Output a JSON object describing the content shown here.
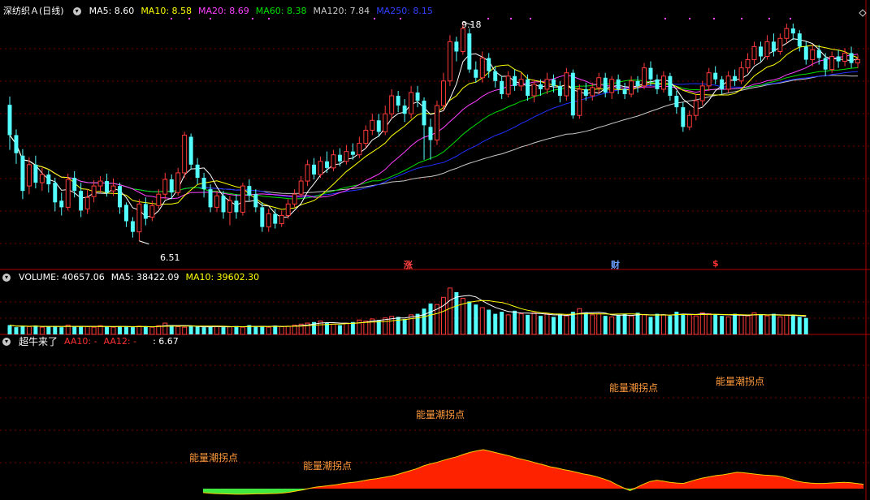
{
  "price_header": {
    "stock_name": "深纺织Ａ(日线)",
    "ma5": "MA5: 8.60",
    "ma10": "MA10: 8.58",
    "ma20": "MA20: 8.69",
    "ma60": "MA60: 8.38",
    "ma120": "MA120: 7.84",
    "ma250": "MA250: 8.15",
    "toggle_icon": "chevron-down-icon"
  },
  "volume_header": {
    "title": "VOLUME: 40657.06",
    "ma5": "MA5: 38422.09",
    "ma10": "MA10: 39602.30"
  },
  "indicator_header": {
    "title": "超牛来了",
    "aa10": "AA10: -",
    "aa12": "AA12: -",
    "value": ": 6.67"
  },
  "price_annotations": {
    "high_label": "9.18",
    "low_label": "6.51"
  },
  "event_markers": [
    {
      "text": "涨",
      "color": "#ff4040"
    },
    {
      "text": "财",
      "color": "#6aa0ff"
    },
    {
      "text": "$",
      "color": "#ff3030"
    }
  ],
  "indicator_labels": [
    "能量潮拐点",
    "能量潮拐点",
    "能量潮拐点",
    "能量潮拐点",
    "能量潮拐点"
  ],
  "colors": {
    "up": "#ff3a3a",
    "down": "#54ffff",
    "ma5": "#ffffff",
    "ma10": "#ffff00",
    "ma20": "#ff40ff",
    "ma60": "#00e000",
    "ma120": "#c8c8c8",
    "ma250": "#2030ff",
    "indicator_positive": "#ff2200",
    "indicator_negative": "#40e840",
    "grid": "#7a0000"
  },
  "chart_data": {
    "type": "candlestick",
    "y_range": [
      6.3,
      9.25
    ],
    "high": 9.18,
    "low": 6.51,
    "candles": [
      [
        8.17,
        7.8,
        8.27,
        7.62
      ],
      [
        7.8,
        7.58,
        7.87,
        7.45
      ],
      [
        7.55,
        7.12,
        7.63,
        7.02
      ],
      [
        7.18,
        7.44,
        7.53,
        7.08
      ],
      [
        7.44,
        7.22,
        7.55,
        7.15
      ],
      [
        7.22,
        7.32,
        7.4,
        7.12
      ],
      [
        7.32,
        7.2,
        7.37,
        7.1
      ],
      [
        7.22,
        6.98,
        7.28,
        6.87
      ],
      [
        7.0,
        6.92,
        7.1,
        6.82
      ],
      [
        6.92,
        7.26,
        7.33,
        6.88
      ],
      [
        7.28,
        7.12,
        7.36,
        7.04
      ],
      [
        7.12,
        6.88,
        7.22,
        6.8
      ],
      [
        6.9,
        7.04,
        7.14,
        6.84
      ],
      [
        7.05,
        7.18,
        7.25,
        6.98
      ],
      [
        7.18,
        7.24,
        7.3,
        7.1
      ],
      [
        7.24,
        7.1,
        7.33,
        7.05
      ],
      [
        7.12,
        7.18,
        7.27,
        7.06
      ],
      [
        7.18,
        6.92,
        7.22,
        6.84
      ],
      [
        6.95,
        6.75,
        6.98,
        6.68
      ],
      [
        6.75,
        6.62,
        6.8,
        6.55
      ],
      [
        6.62,
        6.96,
        7.02,
        6.51
      ],
      [
        6.96,
        6.78,
        7.04,
        6.7
      ],
      [
        6.8,
        6.94,
        7.0,
        6.75
      ],
      [
        6.94,
        7.08,
        7.14,
        6.9
      ],
      [
        7.08,
        7.26,
        7.34,
        7.02
      ],
      [
        7.26,
        7.1,
        7.32,
        7.02
      ],
      [
        7.1,
        7.34,
        7.4,
        7.06
      ],
      [
        7.34,
        7.8,
        7.84,
        7.28
      ],
      [
        7.78,
        7.44,
        7.82,
        7.38
      ],
      [
        7.44,
        7.28,
        7.52,
        7.2
      ],
      [
        7.28,
        7.14,
        7.34,
        7.04
      ],
      [
        7.14,
        6.92,
        7.2,
        6.86
      ],
      [
        6.92,
        7.06,
        7.12,
        6.86
      ],
      [
        7.06,
        6.86,
        7.12,
        6.78
      ],
      [
        6.86,
        7.0,
        7.06,
        6.7
      ],
      [
        7.0,
        6.86,
        7.08,
        6.78
      ],
      [
        6.86,
        7.18,
        7.22,
        6.82
      ],
      [
        7.18,
        7.06,
        7.26,
        7.0
      ],
      [
        7.08,
        6.92,
        7.14,
        6.86
      ],
      [
        6.92,
        6.68,
        6.98,
        6.62
      ],
      [
        6.68,
        6.84,
        6.9,
        6.62
      ],
      [
        6.84,
        6.72,
        6.9,
        6.66
      ],
      [
        6.72,
        6.82,
        6.88,
        6.68
      ],
      [
        6.82,
        6.96,
        7.02,
        6.78
      ],
      [
        6.96,
        7.08,
        7.14,
        6.92
      ],
      [
        7.08,
        7.24,
        7.3,
        7.04
      ],
      [
        7.24,
        7.44,
        7.5,
        7.18
      ],
      [
        7.44,
        7.32,
        7.52,
        7.26
      ],
      [
        7.32,
        7.48,
        7.54,
        7.28
      ],
      [
        7.48,
        7.4,
        7.6,
        7.34
      ],
      [
        7.4,
        7.56,
        7.62,
        7.36
      ],
      [
        7.56,
        7.48,
        7.64,
        7.42
      ],
      [
        7.48,
        7.6,
        7.68,
        7.44
      ],
      [
        7.6,
        7.56,
        7.7,
        7.5
      ],
      [
        7.56,
        7.7,
        7.78,
        7.52
      ],
      [
        7.7,
        7.86,
        7.92,
        7.64
      ],
      [
        7.86,
        7.98,
        8.06,
        7.8
      ],
      [
        7.98,
        7.84,
        8.06,
        7.78
      ],
      [
        7.84,
        8.06,
        8.16,
        7.8
      ],
      [
        8.06,
        8.28,
        8.36,
        8.0
      ],
      [
        8.28,
        8.16,
        8.34,
        8.08
      ],
      [
        8.16,
        8.06,
        8.24,
        7.96
      ],
      [
        8.06,
        8.32,
        8.4,
        8.0
      ],
      [
        8.32,
        8.22,
        8.4,
        8.14
      ],
      [
        8.22,
        7.92,
        8.26,
        7.5
      ],
      [
        7.9,
        7.74,
        8.0,
        7.5
      ],
      [
        7.74,
        8.16,
        8.22,
        7.68
      ],
      [
        8.16,
        8.46,
        8.56,
        8.1
      ],
      [
        8.46,
        8.94,
        9.02,
        8.4
      ],
      [
        8.94,
        8.82,
        9.0,
        8.7
      ],
      [
        8.82,
        9.1,
        9.18,
        8.78
      ],
      [
        9.04,
        8.6,
        9.1,
        8.56
      ],
      [
        8.6,
        8.5,
        8.7,
        8.44
      ],
      [
        8.5,
        8.74,
        8.82,
        8.44
      ],
      [
        8.74,
        8.58,
        8.8,
        8.5
      ],
      [
        8.58,
        8.46,
        8.64,
        8.38
      ],
      [
        8.46,
        8.3,
        8.52,
        8.24
      ],
      [
        8.3,
        8.52,
        8.58,
        8.26
      ],
      [
        8.52,
        8.4,
        8.6,
        8.34
      ],
      [
        8.4,
        8.48,
        8.56,
        8.34
      ],
      [
        8.48,
        8.28,
        8.54,
        8.22
      ],
      [
        8.28,
        8.42,
        8.48,
        8.2
      ],
      [
        8.42,
        8.36,
        8.48,
        8.28
      ],
      [
        8.36,
        8.48,
        8.56,
        8.3
      ],
      [
        8.48,
        8.4,
        8.54,
        8.32
      ],
      [
        8.4,
        8.28,
        8.46,
        8.2
      ],
      [
        8.28,
        8.56,
        8.62,
        8.22
      ],
      [
        8.56,
        8.04,
        8.6,
        8.0
      ],
      [
        8.04,
        8.36,
        8.42,
        8.0
      ],
      [
        8.36,
        8.28,
        8.44,
        8.22
      ],
      [
        8.28,
        8.38,
        8.44,
        8.22
      ],
      [
        8.38,
        8.5,
        8.56,
        8.3
      ],
      [
        8.5,
        8.32,
        8.56,
        8.26
      ],
      [
        8.32,
        8.48,
        8.52,
        8.24
      ],
      [
        8.48,
        8.36,
        8.54,
        8.3
      ],
      [
        8.36,
        8.3,
        8.44,
        8.24
      ],
      [
        8.3,
        8.46,
        8.52,
        8.26
      ],
      [
        8.46,
        8.4,
        8.52,
        8.32
      ],
      [
        8.4,
        8.62,
        8.68,
        8.36
      ],
      [
        8.62,
        8.48,
        8.7,
        8.4
      ],
      [
        8.48,
        8.36,
        8.54,
        8.3
      ],
      [
        8.36,
        8.52,
        8.58,
        8.32
      ],
      [
        8.52,
        8.28,
        8.56,
        8.22
      ],
      [
        8.28,
        8.14,
        8.34,
        8.06
      ],
      [
        8.14,
        7.9,
        8.2,
        7.84
      ],
      [
        7.9,
        8.04,
        8.1,
        7.86
      ],
      [
        8.04,
        8.22,
        8.3,
        7.98
      ],
      [
        8.22,
        8.4,
        8.46,
        8.16
      ],
      [
        8.4,
        8.56,
        8.62,
        8.34
      ],
      [
        8.56,
        8.48,
        8.64,
        8.42
      ],
      [
        8.48,
        8.36,
        8.52,
        8.3
      ],
      [
        8.36,
        8.52,
        8.58,
        8.32
      ],
      [
        8.52,
        8.46,
        8.6,
        8.4
      ],
      [
        8.46,
        8.62,
        8.7,
        8.42
      ],
      [
        8.62,
        8.72,
        8.8,
        8.56
      ],
      [
        8.72,
        8.88,
        8.94,
        8.66
      ],
      [
        8.88,
        8.76,
        8.94,
        8.7
      ],
      [
        8.76,
        8.94,
        9.02,
        8.72
      ],
      [
        8.94,
        8.82,
        9.04,
        8.76
      ],
      [
        8.82,
        8.98,
        9.04,
        8.78
      ],
      [
        8.98,
        9.1,
        9.16,
        8.92
      ],
      [
        9.1,
        9.04,
        9.16,
        8.96
      ],
      [
        9.04,
        8.88,
        9.08,
        8.82
      ],
      [
        8.88,
        8.72,
        8.94,
        8.66
      ],
      [
        8.72,
        8.84,
        8.9,
        8.64
      ],
      [
        8.84,
        8.74,
        8.9,
        8.66
      ],
      [
        8.74,
        8.6,
        8.8,
        8.52
      ],
      [
        8.6,
        8.76,
        8.82,
        8.56
      ],
      [
        8.76,
        8.7,
        8.84,
        8.62
      ],
      [
        8.7,
        8.8,
        8.86,
        8.64
      ],
      [
        8.8,
        8.68,
        8.88,
        8.62
      ],
      [
        8.68,
        8.72,
        8.78,
        8.62
      ]
    ],
    "volume": [
      18,
      14,
      16,
      15,
      17,
      14,
      15,
      16,
      14,
      18,
      15,
      16,
      15,
      14,
      17,
      15,
      14,
      16,
      15,
      14,
      16,
      15,
      14,
      17,
      22,
      18,
      15,
      14,
      16,
      15,
      14,
      15,
      16,
      14,
      15,
      16,
      14,
      18,
      15,
      16,
      14,
      17,
      15,
      16,
      18,
      20,
      22,
      24,
      26,
      22,
      20,
      18,
      22,
      24,
      28,
      26,
      30,
      28,
      32,
      35,
      34,
      30,
      38,
      40,
      50,
      60,
      58,
      72,
      90,
      82,
      70,
      64,
      58,
      52,
      48,
      40,
      44,
      38,
      46,
      40,
      38,
      42,
      36,
      40,
      34,
      38,
      36,
      44,
      50,
      42,
      38,
      40,
      36,
      34,
      38,
      40,
      36,
      42,
      38,
      34,
      40,
      38,
      36,
      44,
      40,
      38,
      36,
      42,
      40,
      38,
      36,
      34,
      40,
      38,
      36,
      42,
      38,
      36,
      40,
      34,
      38,
      36,
      34,
      32
    ],
    "indicator": [
      -2,
      -2.3,
      -2.5,
      -2.6,
      -2.7,
      -2.8,
      -2.8,
      -2.7,
      -2.6,
      -2.6,
      -2.5,
      -2.4,
      -2.2,
      -1.8,
      -1.2,
      -0.6,
      0.2,
      0.8,
      1.2,
      1.6,
      2.0,
      2.6,
      3.0,
      3.4,
      4.0,
      4.6,
      5.0,
      5.6,
      6.2,
      7.0,
      8.0,
      9.0,
      10.0,
      11.4,
      12.4,
      13.2,
      14.2,
      15.2,
      16.0,
      17.2,
      18.2,
      19.0,
      19.6,
      18.8,
      18.0,
      17.2,
      16.4,
      15.4,
      14.6,
      13.8,
      12.8,
      12.0,
      11.0,
      10.4,
      9.6,
      9.0,
      8.2,
      7.4,
      6.8,
      6.0,
      5.0,
      3.8,
      2.0,
      0.4,
      -1.0,
      0.6,
      2.2,
      3.6,
      4.2,
      3.8,
      3.2,
      2.8,
      2.6,
      3.6,
      4.6,
      5.4,
      6.0,
      6.6,
      7.0,
      7.6,
      8.2,
      8.0,
      7.6,
      7.2,
      6.8,
      6.6,
      6.4,
      5.8,
      4.8,
      3.8,
      3.2,
      2.8,
      2.6,
      2.6,
      2.8,
      3.0,
      3.2,
      3.0,
      2.6,
      2.2
    ]
  }
}
